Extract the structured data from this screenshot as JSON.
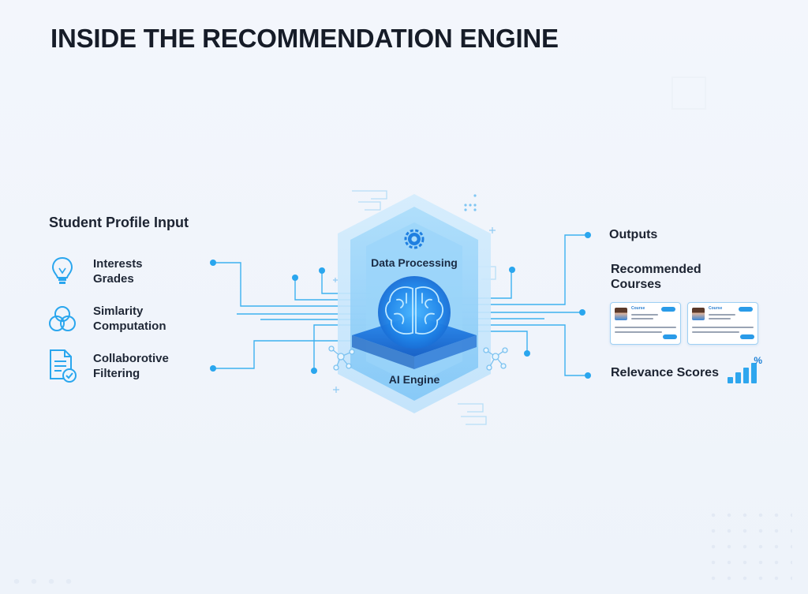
{
  "title": "INSIDE THE RECOMMENDATION ENGINE",
  "input": {
    "heading": "Student Profile Input",
    "items": [
      {
        "line1": "Interests",
        "line2": "Grades",
        "icon": "lightbulb-icon"
      },
      {
        "line1": "Simlarity",
        "line2": "Computation",
        "icon": "overlap-circles-icon"
      },
      {
        "line1": "Collaborotive",
        "line2": "Filtering",
        "icon": "document-check-icon"
      }
    ]
  },
  "engine": {
    "top_label": "Data Processing",
    "bottom_label": "AI Engine",
    "icons": [
      "gear-icon",
      "brain-icon"
    ]
  },
  "outputs": {
    "heading": "Outputs",
    "recommended_line1": "Recommended",
    "recommended_line2": "Courses",
    "cards": [
      {
        "title": "Course"
      },
      {
        "title": "Course"
      }
    ],
    "scores_label": "Relevance Scores",
    "scores_symbol": "%"
  },
  "colors": {
    "accent": "#2aa6ee",
    "engine_light": "#bfe3fb",
    "engine_mid": "#7cc6f6",
    "engine_dark": "#1f7fe0",
    "text": "#1c2331"
  }
}
